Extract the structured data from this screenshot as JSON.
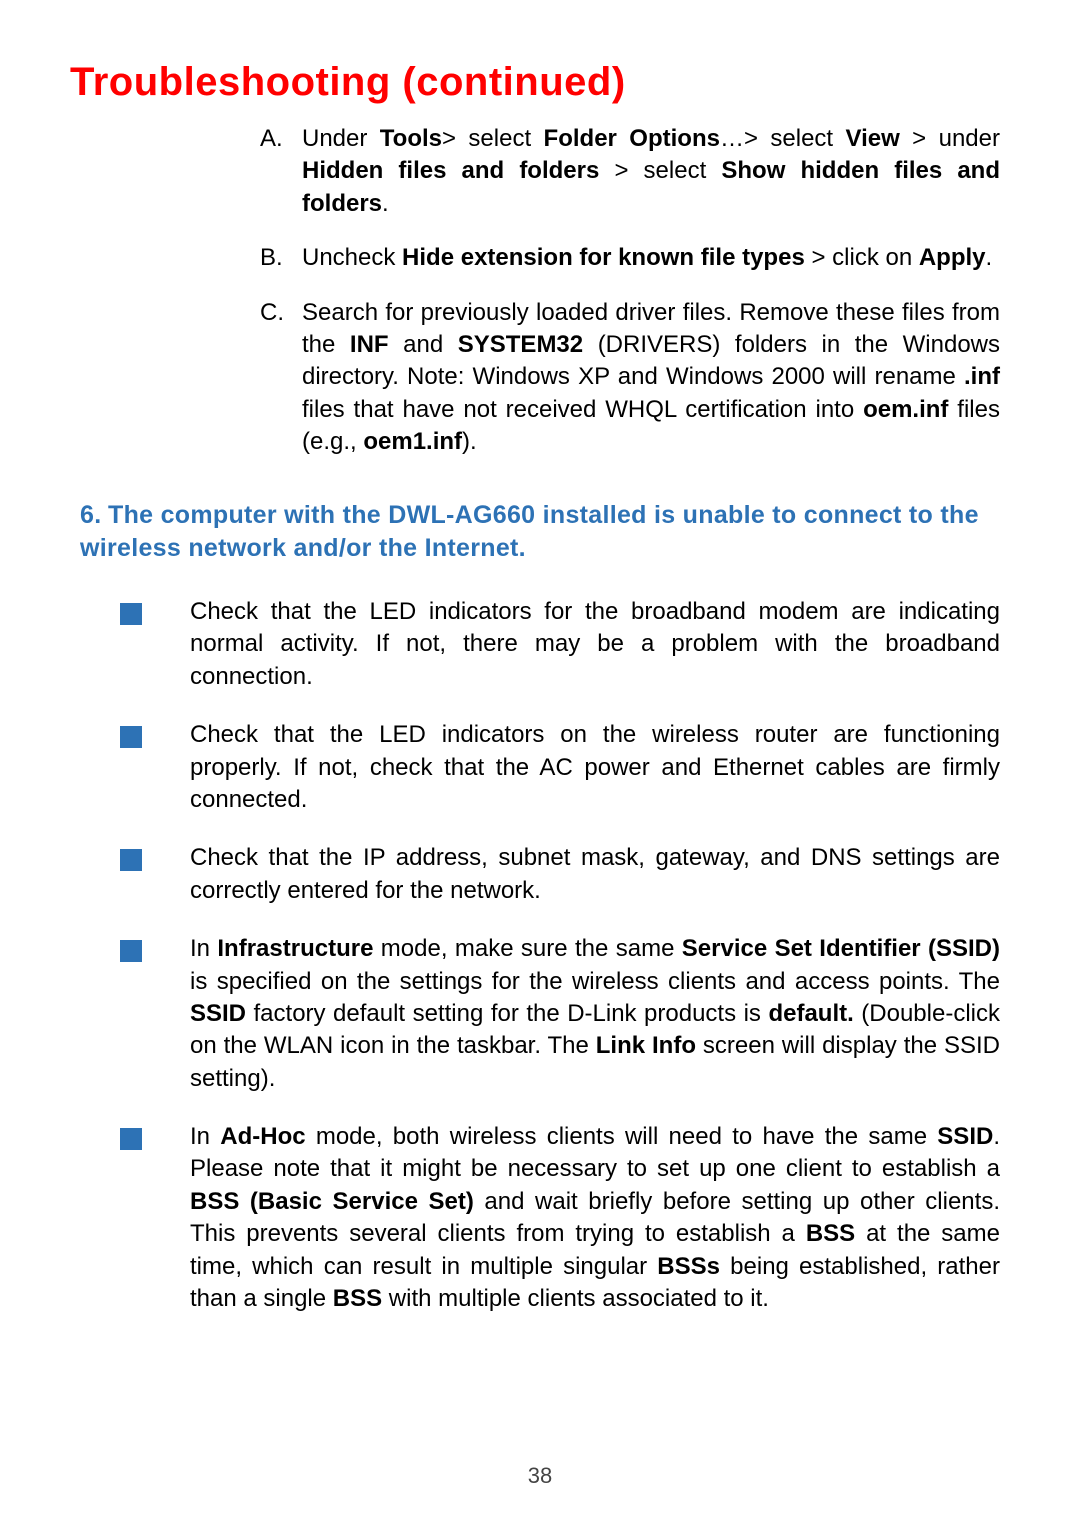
{
  "title": "Troubleshooting (continued)",
  "lettered": [
    {
      "label": "A.",
      "html": "Under <b>Tools</b>> select <b>Folder Options</b>…> select <b>View</b> > under <b>Hidden files and folders</b> > select <b>Show hidden files and folders</b>."
    },
    {
      "label": "B.",
      "html": "Uncheck <b>Hide extension for known file types</b> > click on <b>Apply</b>."
    },
    {
      "label": "C.",
      "html": "Search for previously loaded driver files. Remove these files from the <b>INF</b> and <b>SYSTEM32</b> (DRIVERS) folders in the Windows directory. Note: Windows XP and Windows 2000 will rename <b>.inf</b> files that have not received WHQL certification into <b>oem.inf</b> files (e.g., <b>oem1.inf</b>)."
    }
  ],
  "heading6": {
    "num": "6.",
    "text": "The computer with the DWL-AG660 installed is unable to connect to the wireless network and/or the Internet."
  },
  "bullets": [
    {
      "color": "#2d72b5",
      "html": "Check that the LED indicators for the broadband modem are indicating normal activity. If not, there may be a problem with the broadband connection."
    },
    {
      "color": "#2d72b5",
      "html": "Check that the LED indicators on the wireless router are functioning properly. If not, check that the AC power and Ethernet cables are firmly connected."
    },
    {
      "color": "#2d72b5",
      "html": "Check that the IP address, subnet mask, gateway, and DNS settings are correctly entered for the network."
    },
    {
      "color": "#2d72b5",
      "html": "In <b>Infrastructure</b> mode, make sure the same <b>Service Set Identifier (SSID)</b> is specified on the settings for the wireless clients and access points. The <b>SSID</b> factory default setting for the D-Link products is <b>default.</b>  (Double-click on the WLAN icon in the taskbar. The <b>Link Info</b> screen will display the SSID setting)."
    },
    {
      "color": "#2d72b5",
      "html": "In <b>Ad-Hoc</b> mode, both wireless clients will need to have the same <b>SSID</b>. Please note that it might be necessary to set up one client to establish a <b>BSS (Basic Service Set)</b> and wait briefly before setting up other clients. This prevents several clients from trying to establish a <b>BSS</b> at the same time, which can result in multiple singular <b>BSSs</b> being established, rather than a single <b>BSS</b> with multiple clients associated to it."
    }
  ],
  "pageNumber": "38"
}
